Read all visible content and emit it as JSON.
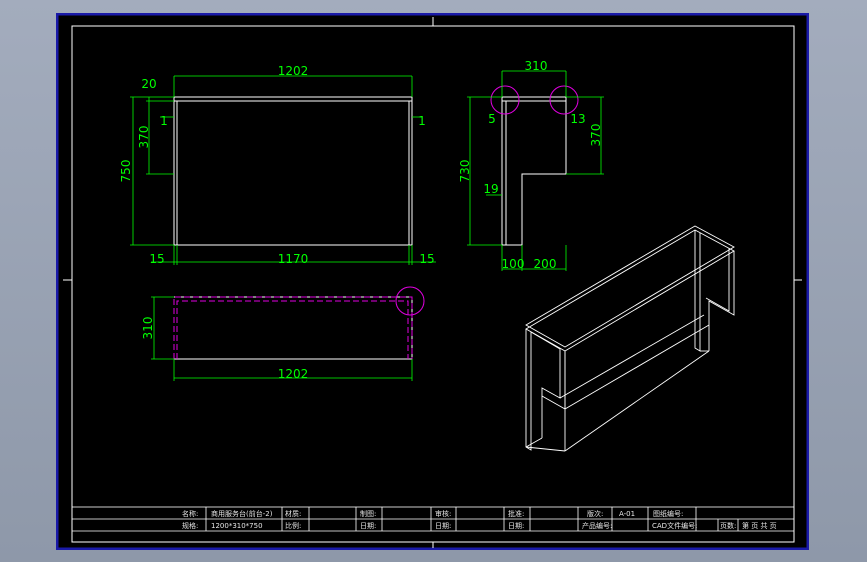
{
  "colors": {
    "background": "#a3acbd",
    "sheet": "#000000",
    "border": "#ffffff",
    "frame_outer": "#1a1aa8",
    "dimension": "#00ff00",
    "hidden_edge": "#e000e0",
    "detail_circle": "#e000e0",
    "geometry": "#ffffff"
  },
  "front_view": {
    "dims": {
      "top_width": "1202",
      "top_thickness": "20",
      "upper_height": "370",
      "total_height": "750",
      "left_inset": "1",
      "right_inset": "1",
      "inner_width": "1170",
      "left_side": "15",
      "right_side": "15"
    }
  },
  "side_view": {
    "dims": {
      "depth": "310",
      "left_gap": "5",
      "right_gap": "13",
      "step_height": "370",
      "height": "730",
      "panel_thickness": "19",
      "base_panel": "100",
      "base_step": "200"
    }
  },
  "top_view": {
    "dims": {
      "depth": "310",
      "width": "1202"
    }
  },
  "title_block": {
    "row1": {
      "name_label": "名称:",
      "name_value": "商用服务台(前台-2)",
      "material_label": "材质:",
      "drawn_label": "制图:",
      "review_label": "审核:",
      "approve_label": "批准:",
      "version_label": "版次:",
      "version_value": "A-01",
      "drawing_no_label": "图纸编号:"
    },
    "row2": {
      "spec_label": "规格:",
      "spec_value": "1200*310*750",
      "scale_label": "比例:",
      "date1_label": "日期:",
      "date2_label": "日期:",
      "date3_label": "日期:",
      "product_no_label": "产品编号:",
      "cad_no_label": "CAD文件编号:",
      "page_label": "页数:",
      "page_sheet": "第 页 共 页"
    }
  }
}
